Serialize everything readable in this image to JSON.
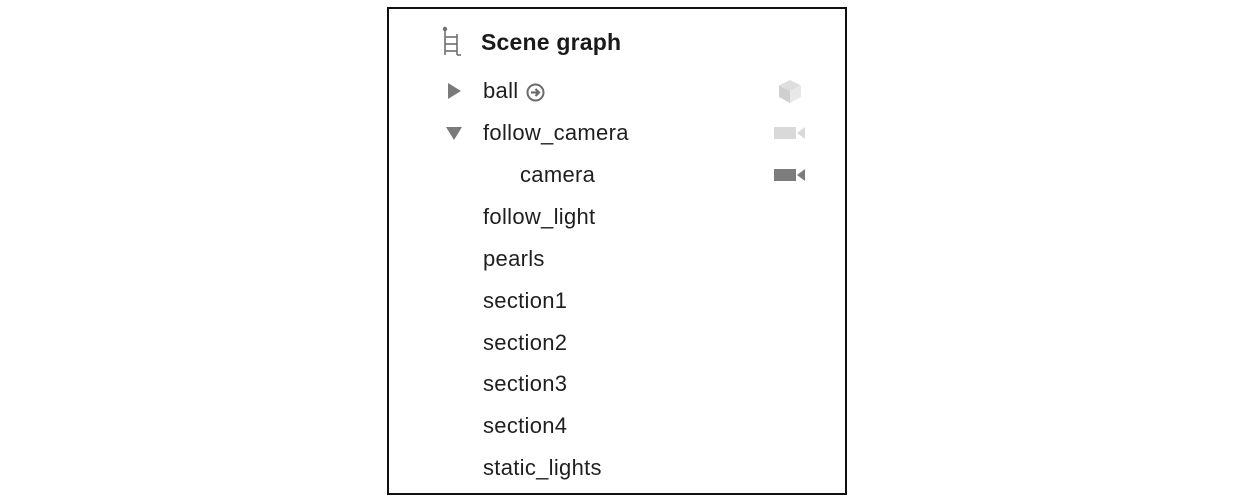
{
  "scene_graph": {
    "title": "Scene graph",
    "header_icon": "hierarchy-tree-icon",
    "nodes": [
      {
        "name": "ball",
        "disclosure": "collapsed",
        "has_reference_arrow": true,
        "type_icon": "geometry-cube-icon"
      },
      {
        "name": "follow_camera",
        "disclosure": "expanded",
        "type_icon": "camera-icon"
      },
      {
        "name": "camera",
        "indent": 1,
        "type_icon": "camera-icon"
      },
      {
        "name": "follow_light"
      },
      {
        "name": "pearls"
      },
      {
        "name": "section1"
      },
      {
        "name": "section2"
      },
      {
        "name": "section3"
      },
      {
        "name": "section4"
      },
      {
        "name": "static_lights"
      }
    ]
  },
  "colors": {
    "border": "#111111",
    "text": "#1f1f1f",
    "disclosure": "#7a7a7a",
    "icon_light": "#d6d6d6",
    "icon_dark": "#7c7c7c"
  }
}
